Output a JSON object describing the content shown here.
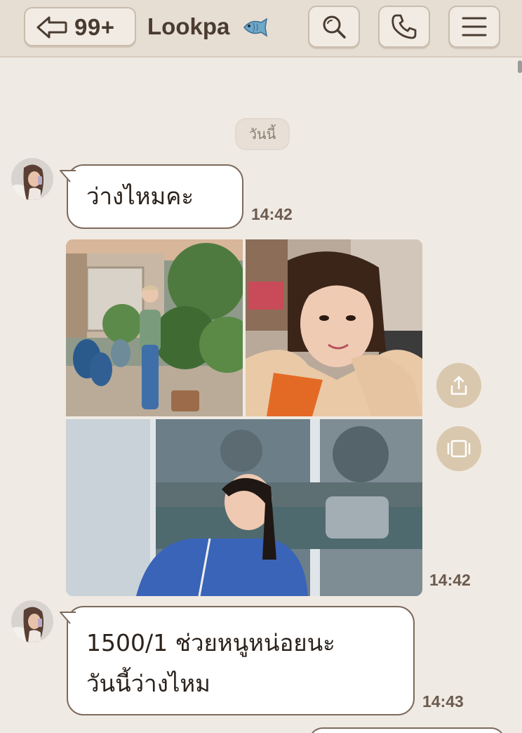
{
  "header": {
    "unread_count": "99+",
    "title": "Lookpa",
    "title_icon": "fish-icon",
    "buttons": [
      "back-arrow-icon",
      "search-icon",
      "phone-icon",
      "menu-icon"
    ]
  },
  "date_divider": "วันนี้",
  "messages": [
    {
      "type": "text",
      "lines": [
        "ว่างไหมคะ"
      ],
      "time": "14:42"
    },
    {
      "type": "photos",
      "count": 3,
      "time": "14:42",
      "actions": [
        "share-icon",
        "gallery-icon"
      ]
    },
    {
      "type": "text",
      "lines": [
        "1500/1 ช่วยหนูหน่อยนะ",
        "วันนี้ว่างไหม"
      ],
      "time": "14:43"
    }
  ],
  "colors": {
    "background": "#efeae3",
    "header": "#e6ddd3",
    "bubble_border": "#7d6a5c",
    "text": "#2b221c",
    "accent_button": "#d9c8ad"
  }
}
